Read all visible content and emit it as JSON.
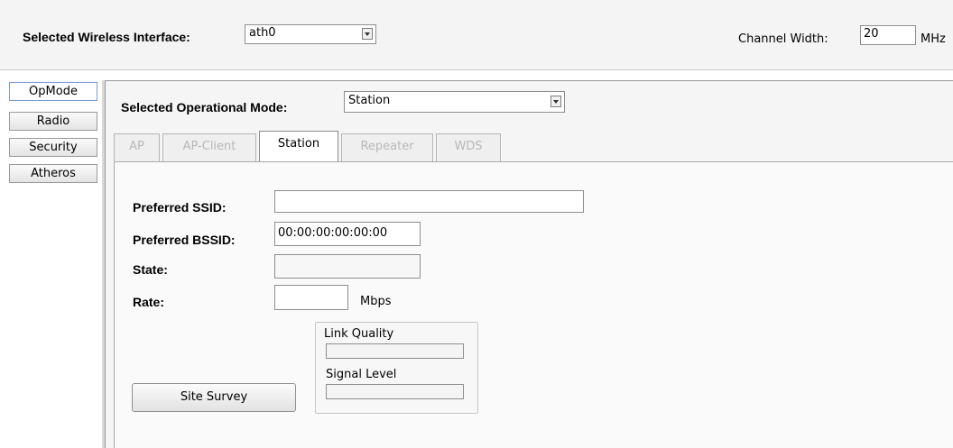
{
  "header": {
    "interface_label": "Selected Wireless Interface:",
    "interface_value": "ath0",
    "channel_width_label": "Channel Width:",
    "channel_width_value": "20",
    "channel_width_unit": "MHz"
  },
  "sidebar": {
    "items": [
      {
        "label": "OpMode",
        "active": true
      },
      {
        "label": "Radio",
        "active": false
      },
      {
        "label": "Security",
        "active": false
      },
      {
        "label": "Atheros",
        "active": false
      }
    ]
  },
  "opmode": {
    "label": "Selected Operational Mode:",
    "value": "Station",
    "tabs": [
      {
        "label": "AP",
        "enabled": false
      },
      {
        "label": "AP-Client",
        "enabled": false
      },
      {
        "label": "Station",
        "enabled": true,
        "active": true
      },
      {
        "label": "Repeater",
        "enabled": false
      },
      {
        "label": "WDS",
        "enabled": false
      }
    ]
  },
  "station": {
    "preferred_ssid_label": "Preferred SSID:",
    "preferred_ssid_value": "",
    "preferred_bssid_label": "Preferred BSSID:",
    "preferred_bssid_value": "00:00:00:00:00:00",
    "state_label": "State:",
    "state_value": "",
    "rate_label": "Rate:",
    "rate_value": "",
    "rate_unit": "Mbps",
    "site_survey_label": "Site Survey",
    "link_quality_label": "Link Quality",
    "link_quality_level": 0,
    "signal_level_label": "Signal Level",
    "signal_level_level": 0
  }
}
